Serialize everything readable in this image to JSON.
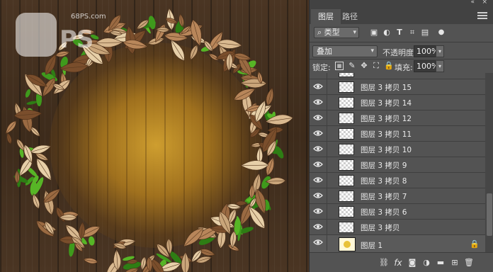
{
  "watermark": {
    "site": "68PS.com",
    "text": "PS"
  },
  "panel": {
    "tabs": [
      {
        "label": "图层",
        "active": true
      },
      {
        "label": "路径",
        "active": false
      }
    ],
    "filter": {
      "label": "类型"
    },
    "blend_mode": "叠加",
    "opacity": {
      "label": "不透明度:",
      "value": "100%"
    },
    "lock": {
      "label": "锁定:"
    },
    "fill": {
      "label": "填充:",
      "value": "100%"
    },
    "layers": [
      {
        "name": "图层 3 拷贝 15"
      },
      {
        "name": "图层 3 拷贝 14"
      },
      {
        "name": "图层 3 拷贝 12"
      },
      {
        "name": "图层 3 拷贝 11"
      },
      {
        "name": "图层 3 拷贝 10"
      },
      {
        "name": "图层 3 拷贝 9"
      },
      {
        "name": "图层 3 拷贝 8"
      },
      {
        "name": "图层 3 拷贝 7"
      },
      {
        "name": "图层 3 拷贝 6"
      },
      {
        "name": "图层 3 拷贝"
      },
      {
        "name": "图层 1"
      }
    ],
    "bottom_icons": [
      "link-icon",
      "fx-icon",
      "mask-icon",
      "adjustment-icon",
      "folder-icon",
      "new-layer-icon",
      "trash-icon"
    ]
  }
}
